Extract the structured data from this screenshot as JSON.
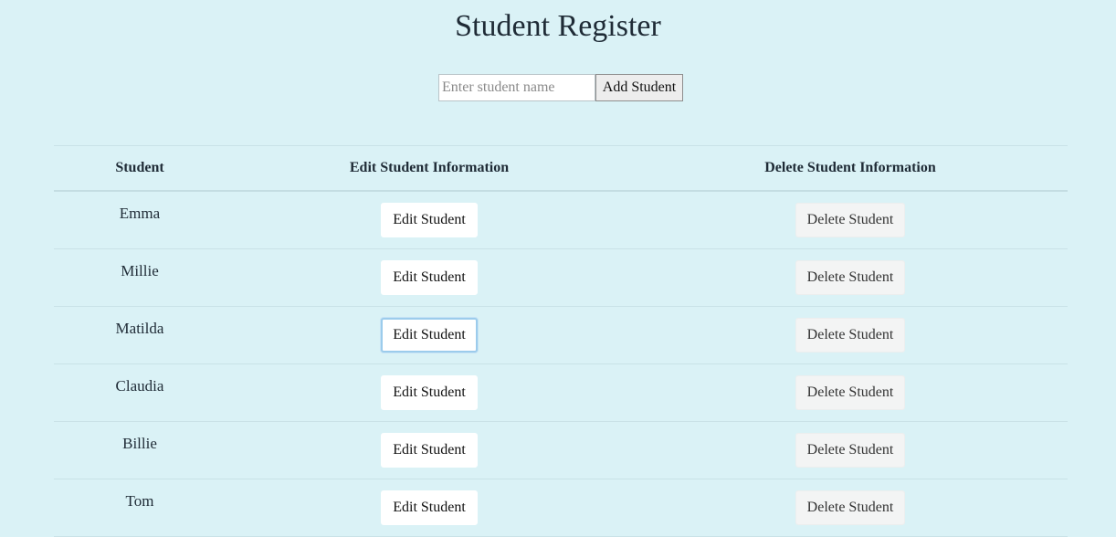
{
  "page": {
    "title": "Student Register"
  },
  "add_form": {
    "placeholder": "Enter student name",
    "value": "",
    "button_label": "Add Student"
  },
  "table": {
    "headers": {
      "student": "Student",
      "edit": "Edit Student Information",
      "delete": "Delete Student Information"
    },
    "rows": [
      {
        "name": "Emma",
        "edit_label": "Edit Student",
        "delete_label": "Delete Student"
      },
      {
        "name": "Millie",
        "edit_label": "Edit Student",
        "delete_label": "Delete Student"
      },
      {
        "name": "Matilda",
        "edit_label": "Edit Student",
        "delete_label": "Delete Student"
      },
      {
        "name": "Claudia",
        "edit_label": "Edit Student",
        "delete_label": "Delete Student"
      },
      {
        "name": "Billie",
        "edit_label": "Edit Student",
        "delete_label": "Delete Student"
      },
      {
        "name": "Tom",
        "edit_label": "Edit Student",
        "delete_label": "Delete Student"
      }
    ],
    "focused_row": 2
  },
  "colors": {
    "background": "#daf2f6",
    "text": "#1f2b36",
    "focus_ring": "#9cccec"
  }
}
